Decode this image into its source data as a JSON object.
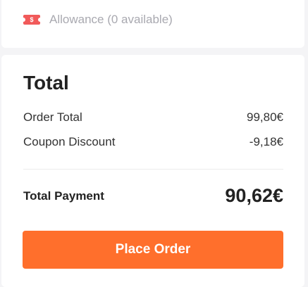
{
  "allowance": {
    "icon": "coupon-icon",
    "icon_glyph": "$",
    "label": "Allowance (0 available)",
    "icon_color": "#f15a5a"
  },
  "summary": {
    "title": "Total",
    "order_total_label": "Order Total",
    "order_total_value": "99,80€",
    "coupon_discount_label": "Coupon Discount",
    "coupon_discount_value": "-9,18€",
    "total_payment_label": "Total Payment",
    "total_payment_value": "90,62€"
  },
  "actions": {
    "place_order_label": "Place Order",
    "accent_color": "#ff6f2c"
  }
}
